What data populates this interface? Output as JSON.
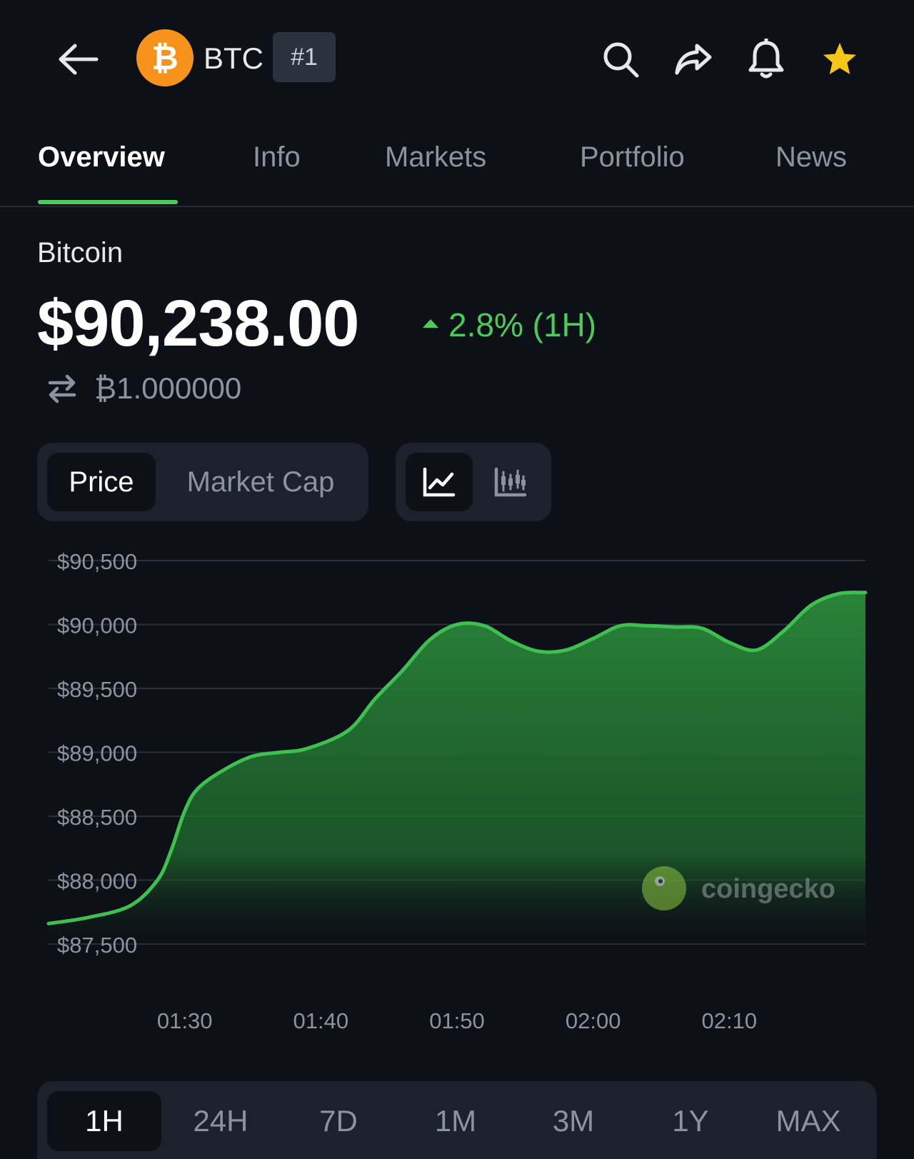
{
  "header": {
    "coin_symbol": "BTC",
    "rank": "#1",
    "coin_logo_glyph": "₿",
    "coin_logo_color": "#f7931a",
    "icons": [
      "back-arrow-icon",
      "search-icon",
      "share-icon",
      "bell-icon",
      "star-icon"
    ],
    "favorite_color": "#f5c518"
  },
  "tabs": [
    {
      "label": "Overview",
      "active": true
    },
    {
      "label": "Info",
      "active": false
    },
    {
      "label": "Markets",
      "active": false
    },
    {
      "label": "Portfolio",
      "active": false
    },
    {
      "label": "News",
      "active": false
    }
  ],
  "coin": {
    "name": "Bitcoin",
    "price": "$90,238.00",
    "change": "2.8% (1H)",
    "conversion": "₿1.000000"
  },
  "chart_toggle": {
    "price_label": "Price",
    "market_cap_label": "Market Cap",
    "selected": "Price",
    "view_selected": "line"
  },
  "chart_data": {
    "type": "area",
    "y_ticks": [
      "$90,500",
      "$90,000",
      "$89,500",
      "$89,000",
      "$88,500",
      "$88,000",
      "$87,500"
    ],
    "x_ticks": [
      "01:30",
      "01:40",
      "01:50",
      "02:00",
      "02:10"
    ],
    "ylim": [
      87500,
      90500
    ],
    "x": [
      "01:20",
      "01:23",
      "01:26",
      "01:28",
      "01:29",
      "01:30",
      "01:31",
      "01:33",
      "01:35",
      "01:37",
      "01:39",
      "01:42",
      "01:44",
      "01:46",
      "01:48",
      "01:50",
      "01:52",
      "01:54",
      "01:56",
      "01:58",
      "02:00",
      "02:02",
      "02:04",
      "02:06",
      "02:08",
      "02:10",
      "02:12",
      "02:14",
      "02:16",
      "02:18",
      "02:20"
    ],
    "values": [
      87660,
      87710,
      87800,
      88000,
      88230,
      88540,
      88720,
      88870,
      88970,
      89000,
      89030,
      89170,
      89420,
      89640,
      89880,
      90000,
      89990,
      89870,
      89790,
      89800,
      89890,
      89990,
      89990,
      89980,
      89970,
      89860,
      89800,
      89950,
      90150,
      90240,
      90250
    ],
    "line_color": "#3fbf4f",
    "fill_color": "#2a8a3a",
    "grid": true,
    "watermark": "coingecko"
  },
  "ranges": {
    "options": [
      "1H",
      "24H",
      "7D",
      "1M",
      "3M",
      "1Y",
      "MAX"
    ],
    "selected": "1H"
  }
}
